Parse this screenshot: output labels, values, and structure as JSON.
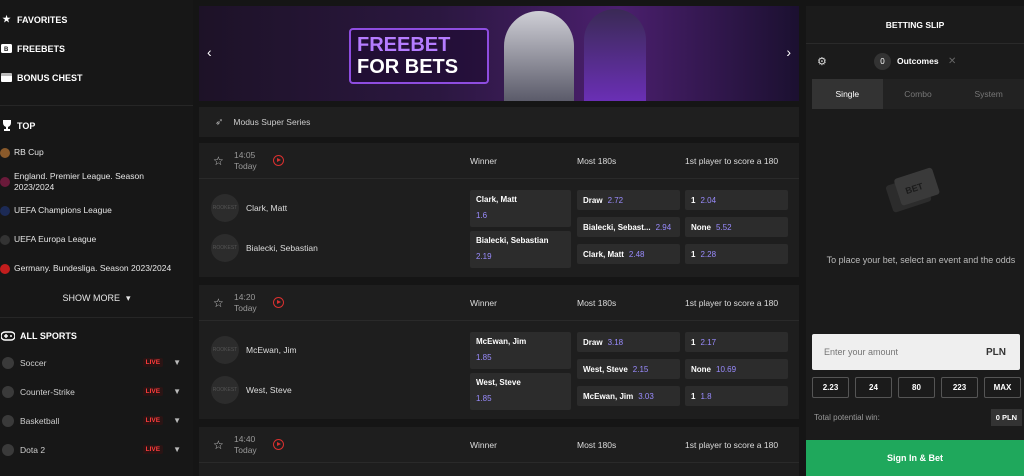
{
  "sidebar": {
    "favorites": "FAVORITES",
    "freebets": "FREEBETS",
    "bonus_chest": "BONUS CHEST",
    "top": "TOP",
    "leagues": [
      {
        "label": "RB Cup",
        "color": "#8a5a2b"
      },
      {
        "label": "England. Premier League. Season 2023/2024",
        "color": "#6a1a3a"
      },
      {
        "label": "UEFA Champions League",
        "color": "#1c2a55"
      },
      {
        "label": "UEFA Europa League",
        "color": "#333333"
      },
      {
        "label": "Germany. Bundesliga. Season 2023/2024",
        "color": "#c21d1d"
      }
    ],
    "show_more": "SHOW MORE",
    "all_sports": "ALL SPORTS",
    "sports": [
      {
        "label": "Soccer",
        "badge": "LIVE"
      },
      {
        "label": "Counter-Strike",
        "badge": "LIVE"
      },
      {
        "label": "Basketball",
        "badge": "LIVE"
      },
      {
        "label": "Dota 2",
        "badge": "LIVE"
      }
    ]
  },
  "banner": {
    "line1": "FREEBET",
    "line2": "FOR BETS"
  },
  "series": "Modus Super Series",
  "matches": [
    {
      "time": "14:05",
      "day": "Today",
      "col1": "Winner",
      "col2": "Most 180s",
      "col3": "1st player to score a 180",
      "p1": "Clark, Matt",
      "p2": "Bialecki, Sebastian",
      "w1_name": "Clark, Matt",
      "w1_odd": "1.6",
      "w2_name": "Bialecki, Sebastian",
      "w2_odd": "2.19",
      "m1_name": "Draw",
      "m1_odd": "2.72",
      "m2_name": "Bialecki, Sebast...",
      "m2_odd": "2.94",
      "m3_name": "Clark, Matt",
      "m3_odd": "2.48",
      "f1_name": "1",
      "f1_odd": "2.04",
      "f2_name": "None",
      "f2_odd": "5.52",
      "f3_name": "1",
      "f3_odd": "2.28"
    },
    {
      "time": "14:20",
      "day": "Today",
      "col1": "Winner",
      "col2": "Most 180s",
      "col3": "1st player to score a 180",
      "p1": "McEwan, Jim",
      "p2": "West, Steve",
      "w1_name": "McEwan, Jim",
      "w1_odd": "1.85",
      "w2_name": "West, Steve",
      "w2_odd": "1.85",
      "m1_name": "Draw",
      "m1_odd": "3.18",
      "m2_name": "West, Steve",
      "m2_odd": "2.15",
      "m3_name": "McEwan, Jim",
      "m3_odd": "3.03",
      "f1_name": "1",
      "f1_odd": "2.17",
      "f2_name": "None",
      "f2_odd": "10.69",
      "f3_name": "1",
      "f3_odd": "1.8"
    },
    {
      "time": "14:40",
      "day": "Today",
      "col1": "Winner",
      "col2": "Most 180s",
      "col3": "1st player to score a 180"
    }
  ],
  "slip": {
    "title": "BETTING SLIP",
    "count": "0",
    "outcomes": "Outcomes",
    "tabs": [
      "Single",
      "Combo",
      "System"
    ],
    "ticket_text": "BET",
    "empty": "To place your bet, select an event and the odds",
    "amount_placeholder": "Enter your amount",
    "currency": "PLN",
    "quick": [
      "2.23",
      "24",
      "80",
      "223",
      "MAX"
    ],
    "potential_label": "Total potential win:",
    "potential_value": "0 PLN",
    "signin": "Sign In & Bet"
  }
}
